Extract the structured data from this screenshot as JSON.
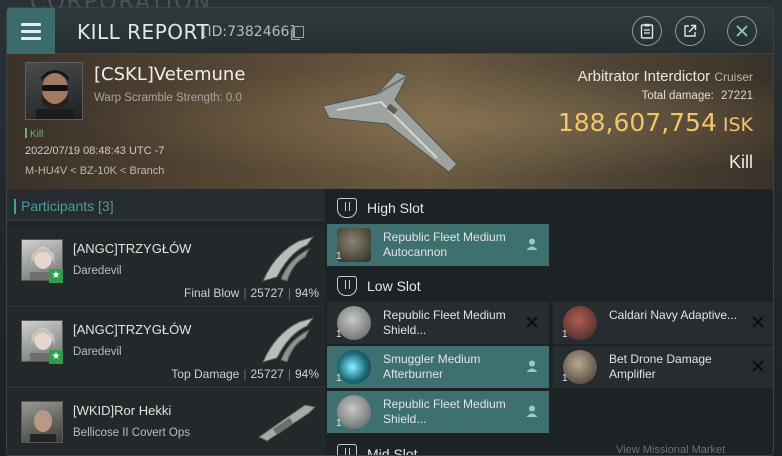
{
  "background": {
    "text": "CORPORATION"
  },
  "header": {
    "title": "KILL REPORT",
    "id": "[ID:7382466]",
    "icons": [
      "menu-icon",
      "clipboard-icon",
      "external-link-icon",
      "close-icon"
    ]
  },
  "victim": {
    "name": "[CSKL]Vetemune",
    "warp_scramble": "Warp Scramble Strength: 0.0",
    "tag": "Kill",
    "datetime": "2022/07/19 08:48:43 UTC -7",
    "location": "M-HU4V < BZ-10K < Branch",
    "ship": "Arbitrator Interdictor",
    "ship_class": "Cruiser",
    "total_damage_label": "Total damage:",
    "total_damage": "27221",
    "isk_value": "188,607,754",
    "isk_unit": "ISK",
    "result": "Kill"
  },
  "participants": {
    "header": "Participants [3]",
    "rows": [
      {
        "name": "[ANGC]TRZYGŁÓW",
        "ship": "Daredevil",
        "label": "Final Blow",
        "damage": "25727",
        "percent": "94%"
      },
      {
        "name": "[ANGC]TRZYGŁÓW",
        "ship": "Daredevil",
        "label": "Top Damage",
        "damage": "25727",
        "percent": "94%"
      },
      {
        "name": "[WKID]Ror Hekki",
        "ship": "Bellicose II Covert Ops",
        "label": "",
        "damage": "",
        "percent": ""
      }
    ]
  },
  "slots": {
    "high": {
      "label": "High Slot",
      "items": [
        {
          "name": "Republic Fleet Medium Autocannon",
          "qty": "1",
          "state": "dropped"
        }
      ]
    },
    "low": {
      "label": "Low Slot",
      "items": [
        {
          "name": "Republic Fleet Medium Shield...",
          "qty": "1",
          "state": "destroyed"
        },
        {
          "name": "Caldari Navy Adaptive...",
          "qty": "1",
          "state": "destroyed"
        },
        {
          "name": "Smuggler Medium Afterburner",
          "qty": "1",
          "state": "dropped"
        },
        {
          "name": "Bet Drone Damage Amplifier",
          "qty": "1",
          "state": "destroyed"
        },
        {
          "name": "Republic Fleet Medium Shield...",
          "qty": "1",
          "state": "dropped"
        }
      ]
    },
    "mid": {
      "label": "Mid Slot"
    }
  },
  "footer": {
    "text": "View Missional Market"
  },
  "colors": {
    "accent": "#3e7070",
    "isk": "#f2c46a",
    "kill_tag": "#6fae82"
  }
}
